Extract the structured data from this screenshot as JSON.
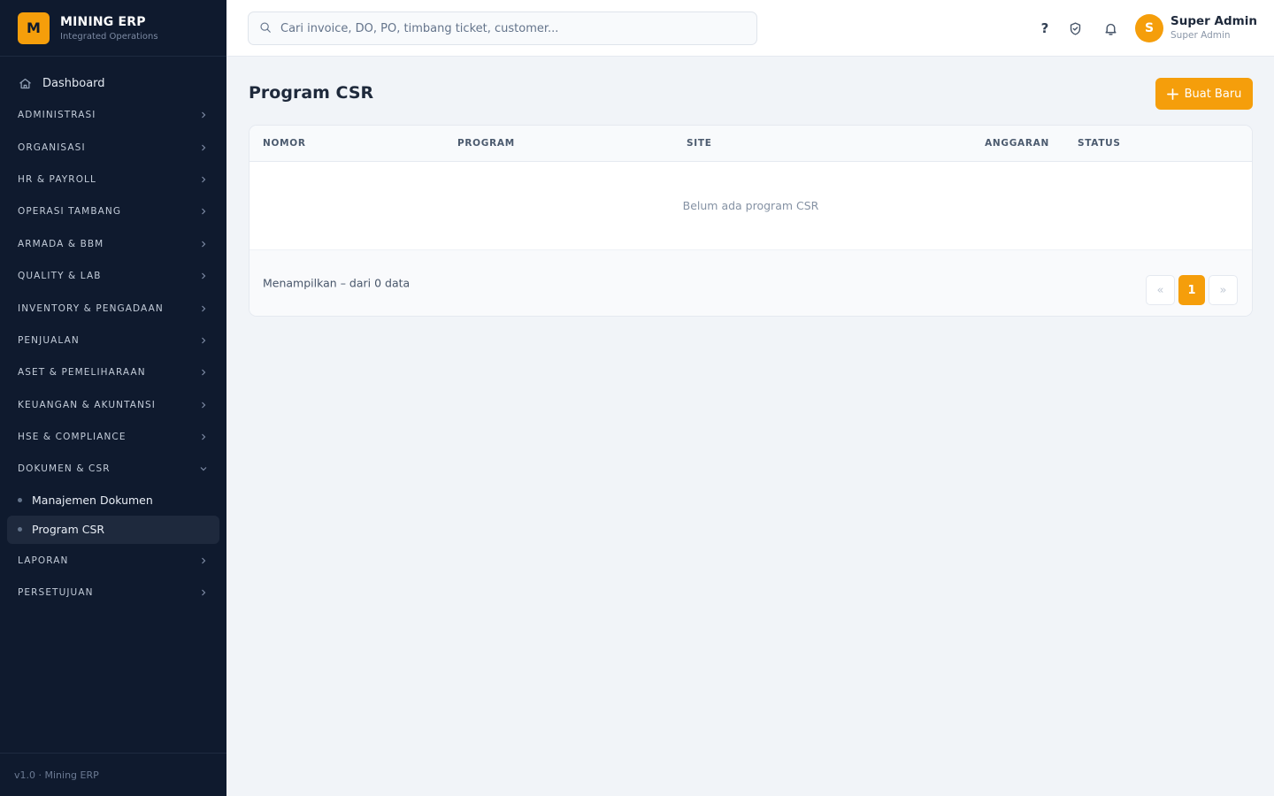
{
  "brand": {
    "logo_letter": "M",
    "name": "MINING ERP",
    "subtitle": "Integrated Operations"
  },
  "sidebar": {
    "dashboard_label": "Dashboard",
    "groups_before": [
      {
        "label": "ADMINISTRASI"
      },
      {
        "label": "ORGANISASI"
      },
      {
        "label": "HR & PAYROLL"
      },
      {
        "label": "OPERASI TAMBANG"
      },
      {
        "label": "ARMADA & BBM"
      },
      {
        "label": "QUALITY & LAB"
      },
      {
        "label": "INVENTORY & PENGADAAN"
      },
      {
        "label": "PENJUALAN"
      },
      {
        "label": "ASET & PEMELIHARAAN"
      },
      {
        "label": "KEUANGAN & AKUNTANSI"
      },
      {
        "label": "HSE & COMPLIANCE"
      }
    ],
    "expanded_group": {
      "label": "DOKUMEN & CSR",
      "items": [
        {
          "label": "Manajemen Dokumen",
          "active": false
        },
        {
          "label": "Program CSR",
          "active": true
        }
      ]
    },
    "groups_after": [
      {
        "label": "LAPORAN"
      },
      {
        "label": "PERSETUJUAN"
      }
    ],
    "footer": "v1.0 · Mining ERP"
  },
  "header": {
    "search_placeholder": "Cari invoice, DO, PO, timbang ticket, customer...",
    "help_glyph": "?",
    "user": {
      "initial": "S",
      "name": "Super Admin",
      "role": "Super Admin"
    }
  },
  "main": {
    "title": "Program CSR",
    "new_button": "Buat Baru",
    "table": {
      "columns": [
        "NOMOR",
        "PROGRAM",
        "SITE",
        "ANGGARAN",
        "STATUS"
      ],
      "empty_text": "Belum ada program CSR",
      "showing_text": "Menampilkan – dari 0 data",
      "pagination": {
        "prev": "«",
        "current": "1",
        "next": "»"
      }
    }
  },
  "colors": {
    "accent": "#f59e0b",
    "sidebar_bg": "#0f1a2e",
    "page_bg": "#f1f4f8"
  }
}
